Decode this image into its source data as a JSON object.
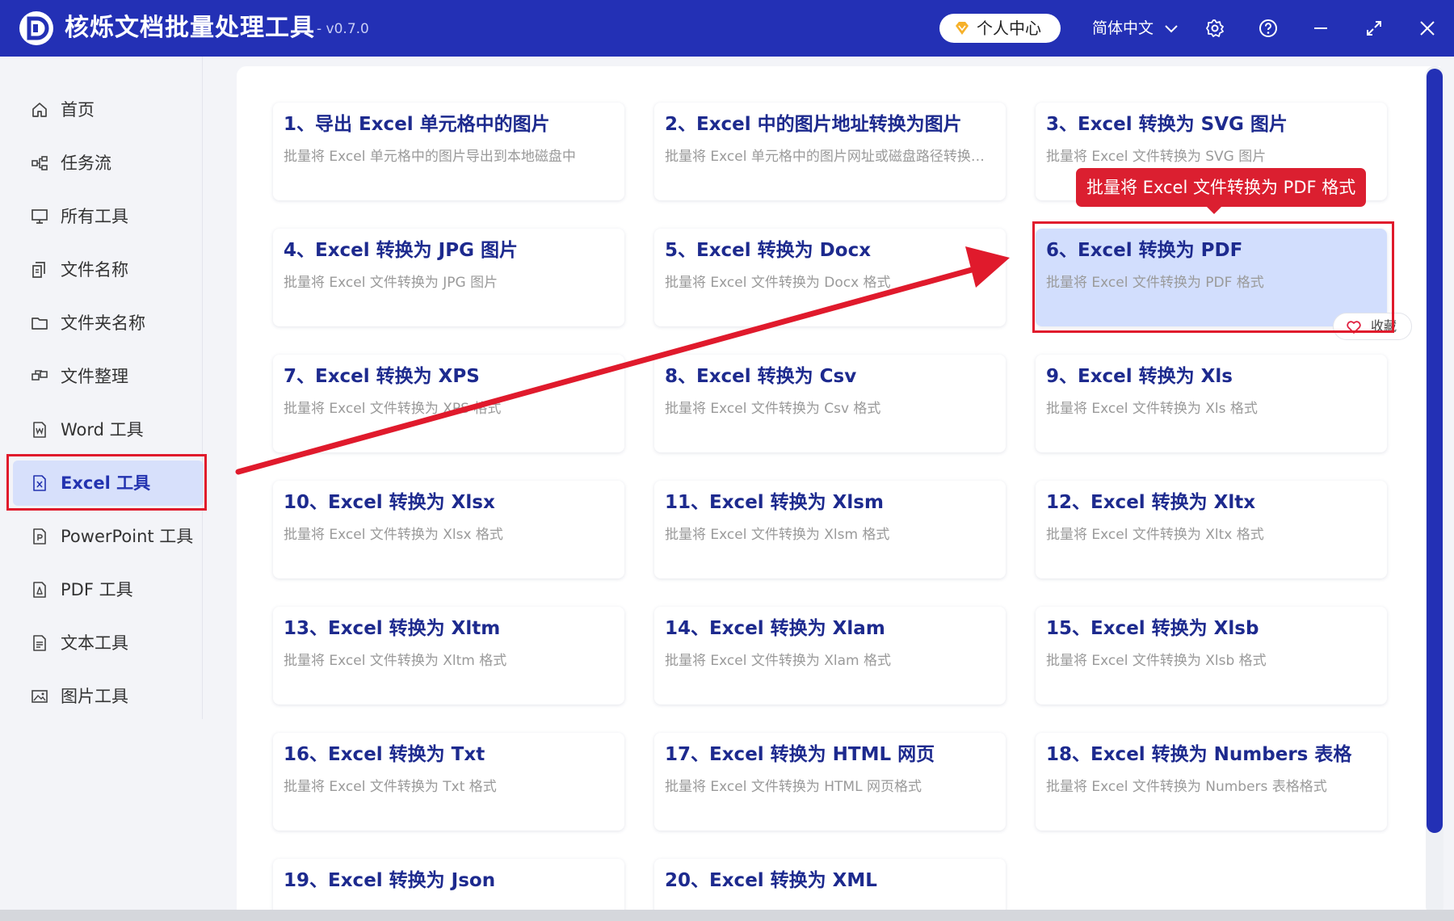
{
  "app": {
    "title": "核烁文档批量处理工具",
    "version": "- v0.7.0",
    "user_center": "个人中心",
    "language": "简体中文"
  },
  "sidebar": {
    "items": [
      {
        "label": "首页",
        "icon": "home-icon"
      },
      {
        "label": "任务流",
        "icon": "workflow-icon"
      },
      {
        "label": "所有工具",
        "icon": "monitor-icon"
      },
      {
        "label": "文件名称",
        "icon": "file-name-icon"
      },
      {
        "label": "文件夹名称",
        "icon": "folder-icon"
      },
      {
        "label": "文件整理",
        "icon": "organize-icon"
      },
      {
        "label": "Word 工具",
        "icon": "word-icon"
      },
      {
        "label": "Excel 工具",
        "icon": "excel-icon",
        "active": true
      },
      {
        "label": "PowerPoint 工具",
        "icon": "powerpoint-icon"
      },
      {
        "label": "PDF 工具",
        "icon": "pdf-icon"
      },
      {
        "label": "文本工具",
        "icon": "text-icon"
      },
      {
        "label": "图片工具",
        "icon": "image-icon"
      }
    ]
  },
  "tools": [
    {
      "title": "1、导出 Excel 单元格中的图片",
      "desc": "批量将 Excel 单元格中的图片导出到本地磁盘中"
    },
    {
      "title": "2、Excel 中的图片地址转换为图片",
      "desc": "批量将 Excel 单元格中的图片网址或磁盘路径转换为图片"
    },
    {
      "title": "3、Excel 转换为 SVG 图片",
      "desc": "批量将 Excel 文件转换为 SVG 图片"
    },
    {
      "title": "4、Excel 转换为 JPG 图片",
      "desc": "批量将 Excel 文件转换为 JPG 图片"
    },
    {
      "title": "5、Excel 转换为 Docx",
      "desc": "批量将 Excel 文件转换为 Docx 格式"
    },
    {
      "title": "6、Excel 转换为 PDF",
      "desc": "批量将 Excel 文件转换为 PDF 格式"
    },
    {
      "title": "7、Excel 转换为 XPS",
      "desc": "批量将 Excel 文件转换为 XPS 格式"
    },
    {
      "title": "8、Excel 转换为 Csv",
      "desc": "批量将 Excel 文件转换为 Csv 格式"
    },
    {
      "title": "9、Excel 转换为 Xls",
      "desc": "批量将 Excel 文件转换为 Xls 格式"
    },
    {
      "title": "10、Excel 转换为 Xlsx",
      "desc": "批量将 Excel 文件转换为 Xlsx 格式"
    },
    {
      "title": "11、Excel 转换为 Xlsm",
      "desc": "批量将 Excel 文件转换为 Xlsm 格式"
    },
    {
      "title": "12、Excel 转换为 Xltx",
      "desc": "批量将 Excel 文件转换为 Xltx 格式"
    },
    {
      "title": "13、Excel 转换为 Xltm",
      "desc": "批量将 Excel 文件转换为 Xltm 格式"
    },
    {
      "title": "14、Excel 转换为 Xlam",
      "desc": "批量将 Excel 文件转换为 Xlam 格式"
    },
    {
      "title": "15、Excel 转换为 Xlsb",
      "desc": "批量将 Excel 文件转换为 Xlsb 格式"
    },
    {
      "title": "16、Excel 转换为 Txt",
      "desc": "批量将 Excel 文件转换为 Txt 格式"
    },
    {
      "title": "17、Excel 转换为 HTML 网页",
      "desc": "批量将 Excel 文件转换为 HTML 网页格式"
    },
    {
      "title": "18、Excel 转换为 Numbers 表格",
      "desc": "批量将 Excel 文件转换为 Numbers 表格格式"
    },
    {
      "title": "19、Excel 转换为 Json",
      "desc": ""
    },
    {
      "title": "20、Excel 转换为 XML",
      "desc": ""
    }
  ],
  "tooltip": "批量将 Excel 文件转换为 PDF 格式",
  "favorite_label": "收藏",
  "colors": {
    "brand": "#2330b5",
    "highlight_red": "#e01a2c",
    "card_title": "#1d2a8e",
    "selected_card": "#d2defd"
  }
}
